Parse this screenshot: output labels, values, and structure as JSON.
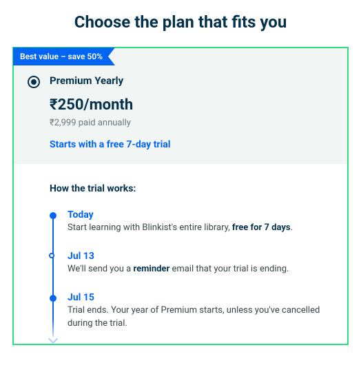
{
  "title": "Choose the plan that fits you",
  "plan": {
    "ribbon": "Best value – save 50%",
    "name": "Premium Yearly",
    "price": "₹250/month",
    "annual": "₹2,999 paid annually",
    "trial_note": "Starts with a free 7-day trial"
  },
  "trial": {
    "heading": "How the trial works:",
    "steps": [
      {
        "title": "Today",
        "desc_pre": "Start learning with Blinkist's entire library, ",
        "desc_bold": "free for 7 days",
        "desc_post": "."
      },
      {
        "title": "Jul 13",
        "desc_pre": "We'll send you a ",
        "desc_bold": "reminder",
        "desc_post": " email that your trial is ending."
      },
      {
        "title": "Jul 15",
        "desc_pre": "Trial ends. Your year of Premium starts, unless you've cancelled during the trial.",
        "desc_bold": "",
        "desc_post": ""
      }
    ]
  }
}
